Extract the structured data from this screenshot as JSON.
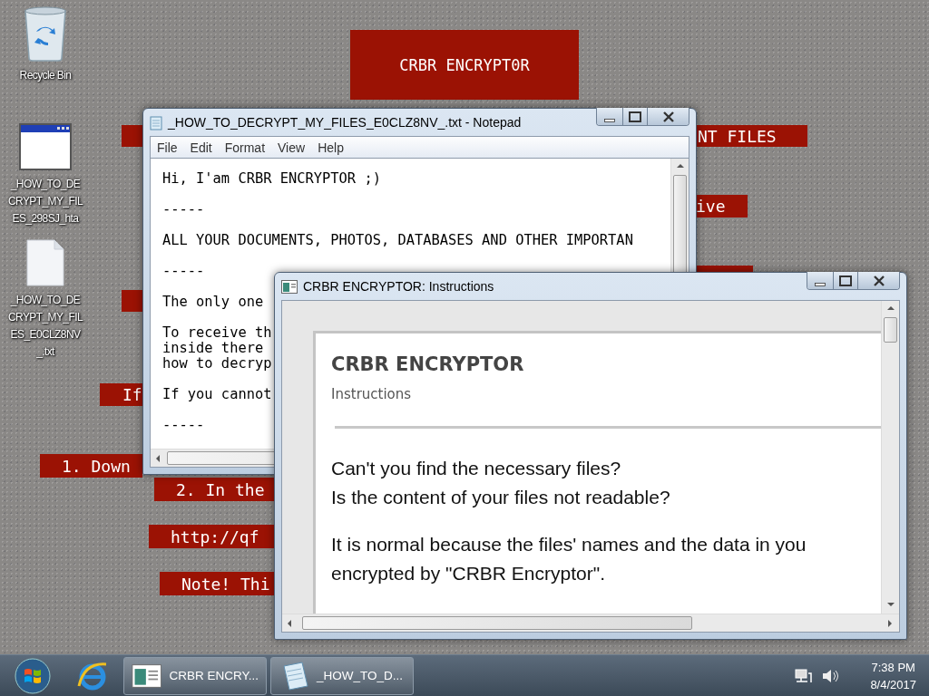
{
  "desktop": {
    "icons": [
      {
        "kind": "recycle",
        "label": "Recycle Bin"
      },
      {
        "kind": "hta",
        "label": "_HOW_TO_DECRYPT_MY_FILES_298SJ_hta"
      },
      {
        "kind": "text",
        "label": "_HOW_TO_DECRYPT_MY_FILES_E0CLZ8NV_.txt"
      }
    ],
    "banners": [
      {
        "text": "CRBR ENCRYPT0R"
      },
      {
        "text": "NT FILES"
      },
      {
        "text": "ive"
      },
      {
        "text": "If"
      },
      {
        "text": "1. Down"
      },
      {
        "text": "2. In the"
      },
      {
        "text": "http://qf"
      },
      {
        "text": "Note! Thi"
      }
    ]
  },
  "notepad": {
    "title": "_HOW_TO_DECRYPT_MY_FILES_E0CLZ8NV_.txt - Notepad",
    "menu": [
      "File",
      "Edit",
      "Format",
      "View",
      "Help"
    ],
    "paragraphs": [
      [
        "Hi, I'am CRBR ENCRYPTOR ;)"
      ],
      [
        "-----"
      ],
      [
        "ALL YOUR DOCUMENTS, PHOTOS, DATABASES AND OTHER IMPORTAN"
      ],
      [
        "-----"
      ],
      [
        "The only one"
      ],
      [
        "To receive th",
        "inside there",
        "how to decryp"
      ],
      [
        "If you cannot"
      ],
      [
        "-----"
      ]
    ]
  },
  "instructions_window": {
    "title": "CRBR ENCRYPTOR: Instructions",
    "heading": "CRBR ENCRYPTOR",
    "subheading": "Instructions",
    "paragraphs": [
      [
        "Can't you find the necessary files?",
        "Is the content of your files not readable?"
      ],
      [
        "It is normal because the files' names and the data in you",
        "encrypted by \"CRBR Encryptor\"."
      ]
    ]
  },
  "taskbar": {
    "buttons": [
      {
        "kind": "app",
        "label": "CRBR ENCRY..."
      },
      {
        "kind": "notepad",
        "label": "_HOW_TO_D..."
      }
    ],
    "clock": {
      "time": "7:38 PM",
      "date": "8/4/2017"
    }
  }
}
